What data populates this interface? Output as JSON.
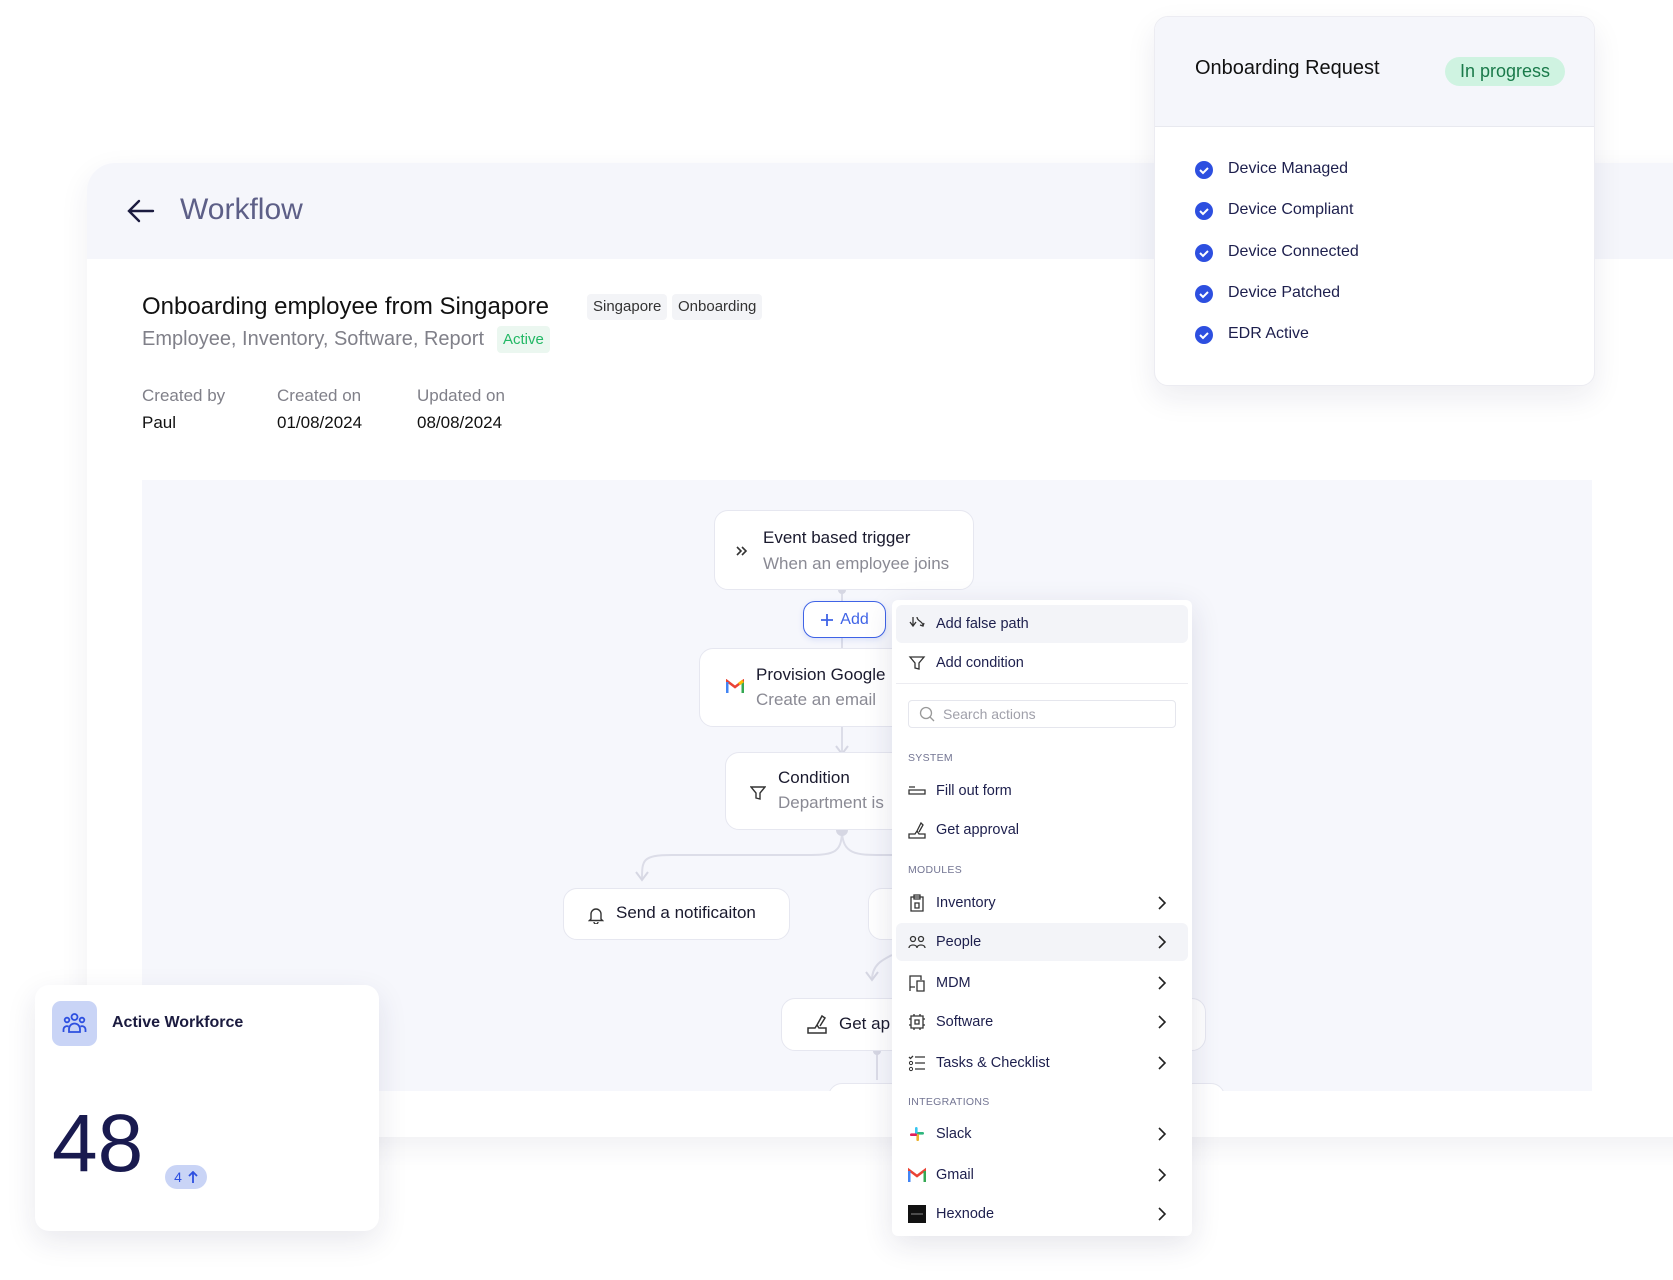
{
  "header": {
    "title": "Workflow",
    "back_icon": "arrow-left-icon"
  },
  "workflow": {
    "name": "Onboarding employee from Singapore",
    "tags": [
      "Singapore",
      "Onboarding"
    ],
    "categories": "Employee, Inventory, Software, Report",
    "status": "Active",
    "meta": [
      {
        "label": "Created by",
        "value": "Paul"
      },
      {
        "label": "Created on",
        "value": "01/08/2024"
      },
      {
        "label": "Updated on",
        "value": "08/08/2024"
      }
    ]
  },
  "nodes": {
    "trigger": {
      "title": "Event based trigger",
      "subtitle": "When an employee joins"
    },
    "add_label": "Add",
    "provision": {
      "title": "Provision Google",
      "subtitle": "Create an email"
    },
    "condition": {
      "title": "Condition",
      "subtitle": "Department is"
    },
    "notify": {
      "title": "Send a notificaiton"
    },
    "approval": {
      "title": "Get ap"
    }
  },
  "menu": {
    "top_actions": [
      {
        "label": "Add false path",
        "icon": "split-path-icon"
      },
      {
        "label": "Add condition",
        "icon": "filter-icon"
      }
    ],
    "search_placeholder": "Search actions",
    "sections": {
      "system": "SYSTEM",
      "modules": "MODULES",
      "integrations": "INTEGRATIONS"
    },
    "system": [
      {
        "label": "Fill out form",
        "icon": "form-icon"
      },
      {
        "label": "Get approval",
        "icon": "approval-icon"
      }
    ],
    "modules": [
      {
        "label": "Inventory",
        "icon": "clipboard-icon"
      },
      {
        "label": "People",
        "icon": "people-icon"
      },
      {
        "label": "MDM",
        "icon": "devices-icon"
      },
      {
        "label": "Software",
        "icon": "chip-icon"
      },
      {
        "label": "Tasks & Checklist",
        "icon": "checklist-icon"
      }
    ],
    "integrations": [
      {
        "label": "Slack",
        "icon": "slack-icon"
      },
      {
        "label": "Gmail",
        "icon": "gmail-icon"
      },
      {
        "label": "Hexnode",
        "icon": "hexnode-icon"
      }
    ],
    "highlighted": [
      "Add false path",
      "People"
    ]
  },
  "request": {
    "title": "Onboarding Request",
    "status": "In progress",
    "checks": [
      "Device Managed",
      "Device Compliant",
      "Device Connected",
      "Device Patched",
      "EDR Active"
    ],
    "status_color": "#cff3e1",
    "check_color": "#2d4fe0"
  },
  "workforce": {
    "title": "Active Workforce",
    "count": "48",
    "delta": "4",
    "trend": "up"
  }
}
